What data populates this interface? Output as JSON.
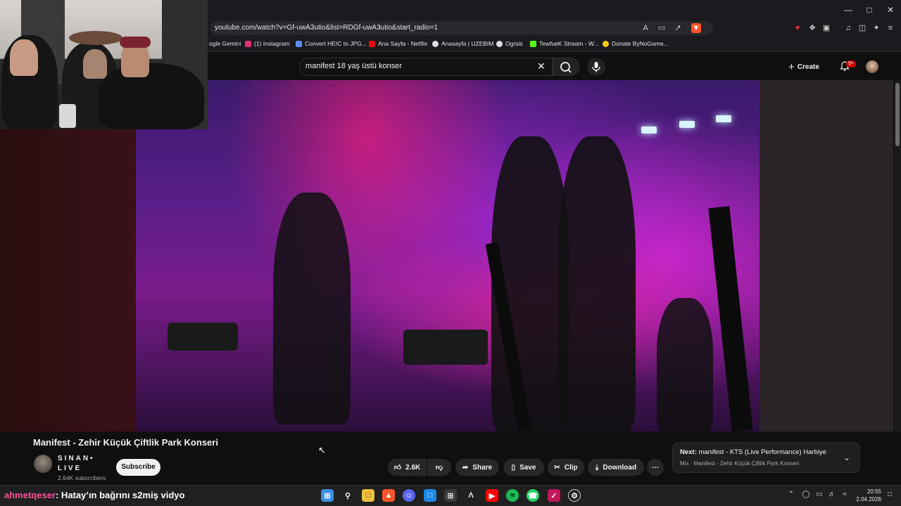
{
  "browser": {
    "url": "youtube.com/watch?v=Gf-uwA3utio&list=RDGf-uwA3utio&start_radio=1",
    "bookmarks": [
      {
        "label": "ogle Gemini",
        "color": "#4c8bf5"
      },
      {
        "label": "(1) Instagram",
        "color": "#e1306c"
      },
      {
        "label": "Convert HEIC to JPG...",
        "color": "#5b8def"
      },
      {
        "label": "Ana Sayfa - Netflix",
        "color": "#e50914"
      },
      {
        "label": "Anasayfa | UZEBIM",
        "color": "#dddddd"
      },
      {
        "label": "Ogrsis",
        "color": "#dddddd"
      },
      {
        "label": "TewfueK Stream - W...",
        "color": "#53fc18"
      },
      {
        "label": "Donate ByNoGame...",
        "color": "#f5c518"
      }
    ]
  },
  "youtube": {
    "search_query": "manifest 18 yaş üstü konser",
    "create_label": "Create",
    "notification_badge": "9+",
    "video_title": "Manifest - Zehir Küçük Çiftlik Park Konseri",
    "channel_name": "SINAN• LIVE",
    "subscribers": "2.64K subscribers",
    "subscribe_label": "Subscribe",
    "actions": {
      "likes": "2.6K",
      "share": "Share",
      "save": "Save",
      "clip": "Clip",
      "download": "Download"
    },
    "next": {
      "prefix": "Next:",
      "title": "manifest - KTS (Live Performance) Harbiye",
      "subtitle": "Mix · Manifest - Zehir Küçük Çiftlik Park Konseri"
    }
  },
  "chat": {
    "user": "ahmetqeser",
    "message": ": Hatay’ın bağrını s2miş vidyo"
  },
  "taskbar": {
    "time": "20:55",
    "date": "2.04.2026"
  }
}
